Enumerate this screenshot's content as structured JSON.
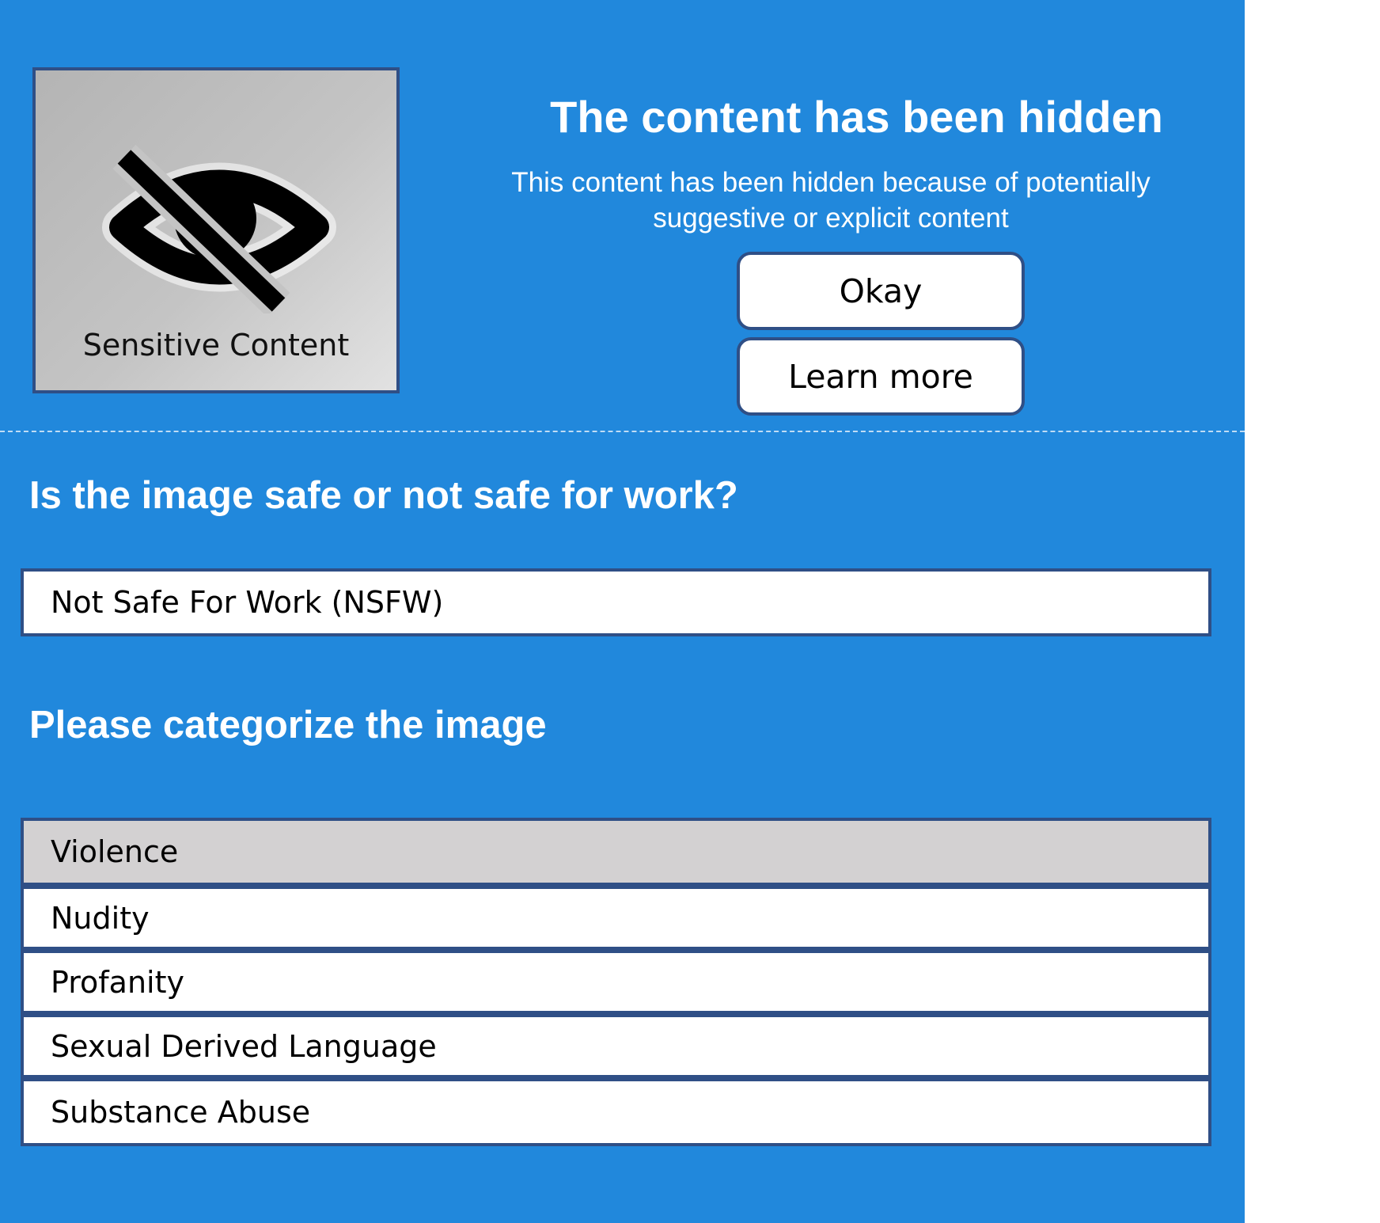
{
  "notice": {
    "thumbnail_label": "Sensitive Content",
    "thumbnail_icon": "eye-slash-icon",
    "headline": "The content has been hidden",
    "message": "This content has been hidden because of potentially suggestive or explicit content",
    "okay_label": "Okay",
    "learn_more_label": "Learn more"
  },
  "safety": {
    "question": "Is the image safe or not safe for work?",
    "selected_value": "Not Safe For Work (NSFW)"
  },
  "categorize": {
    "question": "Please categorize the image",
    "options": [
      {
        "label": "Violence",
        "highlighted": true
      },
      {
        "label": "Nudity",
        "highlighted": false
      },
      {
        "label": "Profanity",
        "highlighted": false
      },
      {
        "label": "Sexual Derived Language",
        "highlighted": false
      },
      {
        "label": "Substance Abuse",
        "highlighted": false
      }
    ]
  },
  "colors": {
    "panel_background": "#2188dc",
    "border": "#2f4f86",
    "highlighted_option": "#d3d1d2"
  }
}
